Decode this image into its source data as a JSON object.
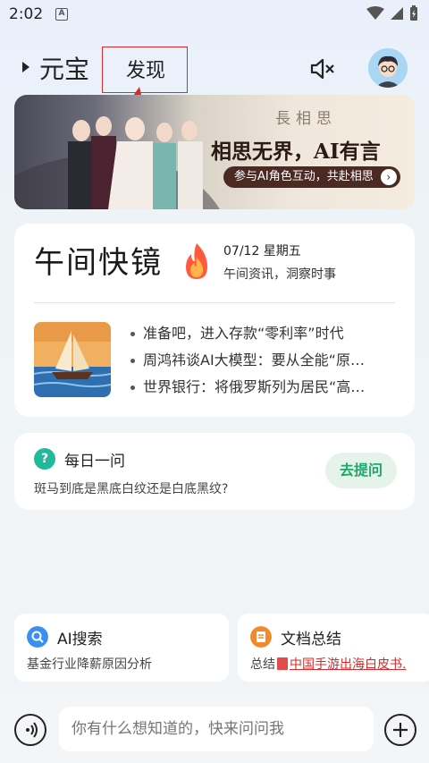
{
  "status_bar": {
    "time": "2:02",
    "notification_letter": "A"
  },
  "header": {
    "tab_yuanbao": "元宝",
    "tab_discover": "发现"
  },
  "banner": {
    "logo_text": "長相思",
    "title": "相思无界，AI有言",
    "cta": "参与AI角色互动，共赴相思"
  },
  "news": {
    "title": "午间快镜",
    "date": "07/12 星期五",
    "subtitle": "午间资讯，洞察时事",
    "items": [
      "准备吧，进入存款“零利率”时代",
      "周鸿祎谈AI大模型：要从全能“原…",
      "世界银行：将俄罗斯列为居民“高…"
    ]
  },
  "daily": {
    "title": "每日一问",
    "question": "斑马到底是黑底白纹还是白底黑纹?",
    "ask_button": "去提问"
  },
  "quick_cards": [
    {
      "title": "AI搜索",
      "sub": "基金行业降薪原因分析",
      "icon": "search-icon",
      "color": "#3b8ff0"
    },
    {
      "title": "文档总结",
      "sub_prefix": "总结",
      "sub_link": "中国手游出海白皮书.",
      "icon": "document-icon",
      "color": "#f08a2a"
    }
  ],
  "input": {
    "placeholder": "你有什么想知道的，快来问问我"
  },
  "colors": {
    "annotation": "#d92b2b",
    "accent_green": "#1da86b"
  }
}
